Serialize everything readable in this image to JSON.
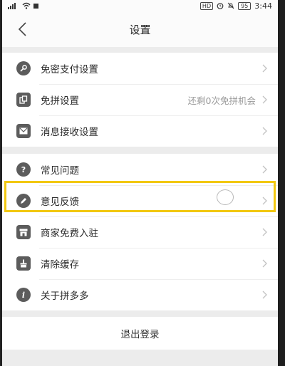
{
  "status_bar": {
    "left_text": "ᵍᵍ",
    "hd": "HD",
    "battery": "95",
    "time": "3:44"
  },
  "navbar": {
    "back_icon": "chevron-left-icon",
    "title": "设置"
  },
  "groups": [
    {
      "items": [
        {
          "name": "no-password-payment",
          "icon": "key-icon",
          "label": "免密支付设置",
          "value": ""
        },
        {
          "name": "free-group-buy",
          "icon": "copy-icon",
          "label": "免拼设置",
          "value": "还剩0次免拼机会"
        },
        {
          "name": "message-receive",
          "icon": "mail-icon",
          "label": "消息接收设置",
          "value": ""
        }
      ]
    },
    {
      "items": [
        {
          "name": "faq",
          "icon": "question-icon",
          "label": "常见问题",
          "value": ""
        },
        {
          "name": "feedback",
          "icon": "pencil-icon",
          "label": "意见反馈",
          "value": ""
        },
        {
          "name": "merchant-join",
          "icon": "store-icon",
          "label": "商家免费入驻",
          "value": ""
        },
        {
          "name": "clear-cache",
          "icon": "broom-icon",
          "label": "清除缓存",
          "value": ""
        },
        {
          "name": "about",
          "icon": "info-icon",
          "label": "关于拼多多",
          "value": ""
        }
      ]
    }
  ],
  "logout_label": "退出登录",
  "colors": {
    "highlight": "#f2c811",
    "icon_bg": "#5c5c5c",
    "page_bg": "#ececec"
  }
}
